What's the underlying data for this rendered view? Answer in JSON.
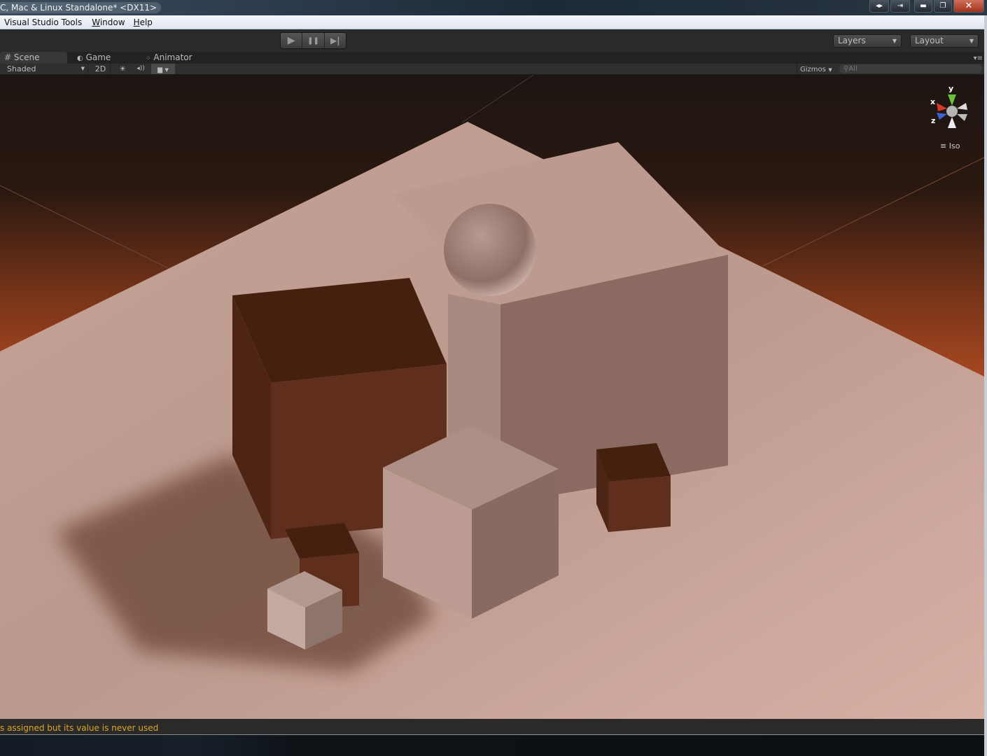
{
  "window": {
    "title": "C, Mac & Linux Standalone* <DX11>",
    "buttons": [
      "restore-arrows",
      "exit",
      "minimize",
      "maximize",
      "close"
    ]
  },
  "menubar": {
    "items": [
      {
        "label": "Visual Studio Tools"
      },
      {
        "label": "Window",
        "accel": "W"
      },
      {
        "label": "Help",
        "accel": "H"
      }
    ]
  },
  "toolbar": {
    "play_icon": "▶",
    "pause_icon": "❚❚",
    "step_icon": "▶|",
    "layers_label": "Layers",
    "layout_label": "Layout"
  },
  "tabs": [
    {
      "label": "Scene",
      "icon": "grid-icon",
      "active": true
    },
    {
      "label": "Game",
      "icon": "pacman-icon",
      "active": false
    },
    {
      "label": "Animator",
      "icon": "animator-icon",
      "active": false
    }
  ],
  "scene_toolbar": {
    "shading_mode": "Shaded",
    "mode_2d": "2D",
    "lighting_icon": "☀",
    "audio_icon": "◂))",
    "effects_icon": "image-icon",
    "gizmos_label": "Gizmos",
    "search_placeholder": "All"
  },
  "gizmo": {
    "x_label": "x",
    "y_label": "y",
    "z_label": "z",
    "projection_label": "Iso",
    "colors": {
      "x": "#d33a2a",
      "y": "#6ac23a",
      "z": "#3a64d3"
    }
  },
  "console": {
    "message": "s assigned but its value is never used",
    "color": "#d9a62c"
  },
  "scene": {
    "sky_top": "#1e1613",
    "sky_horizon": "#a84a25",
    "floor": "#c9a598",
    "dark_cube": "#5e2e1c",
    "dark_cube_top": "#45200f",
    "light_cube": "#b89a90"
  }
}
